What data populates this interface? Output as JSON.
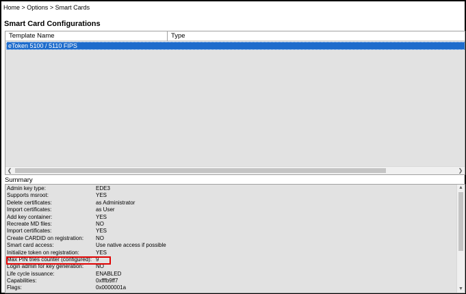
{
  "breadcrumb": {
    "items": [
      "Home",
      "Options",
      "Smart Cards"
    ],
    "separator": " > "
  },
  "page": {
    "title": "Smart Card Configurations"
  },
  "template_list": {
    "columns": [
      "Template Name",
      "Type"
    ],
    "rows": [
      {
        "template_name": "eToken 5100 / 5110 FIPS",
        "type": "",
        "selected": true
      }
    ]
  },
  "summary": {
    "label": "Summary",
    "rows": [
      {
        "key": "Admin key type:",
        "value": "EDE3"
      },
      {
        "key": "Supports msroot:",
        "value": "YES"
      },
      {
        "key": "Delete certificates:",
        "value": "as Administrator"
      },
      {
        "key": "Import certificates:",
        "value": "as User"
      },
      {
        "key": "Add key container:",
        "value": "YES"
      },
      {
        "key": "Recreate MD files:",
        "value": "NO"
      },
      {
        "key": "Import certificates:",
        "value": "YES"
      },
      {
        "key": "Create CARDID on registration:",
        "value": "NO"
      },
      {
        "key": "Smart card access:",
        "value": "Use native access if possible"
      },
      {
        "key": "Initialize token on registration:",
        "value": "YES"
      },
      {
        "key": "Max PIN tries counter (configured):",
        "value": "9"
      },
      {
        "key": "Login admin for key generation:",
        "value": "NO"
      },
      {
        "key": "Life cycle issuance:",
        "value": "ENABLED"
      },
      {
        "key": "Capabilities:",
        "value": "0xfffb9ff7"
      },
      {
        "key": "Flags:",
        "value": "0x0000001a"
      }
    ],
    "highlighted_row": "Max PIN tries counter (configured):"
  },
  "colors": {
    "selection": "#1e6ccc",
    "highlight_box": "#e00000",
    "panel_bg": "#e2e2e2"
  },
  "icons": {
    "scroll_left": "chevron-left-icon",
    "scroll_right": "chevron-right-icon",
    "scroll_up": "chevron-up-icon",
    "scroll_down": "chevron-down-icon"
  }
}
